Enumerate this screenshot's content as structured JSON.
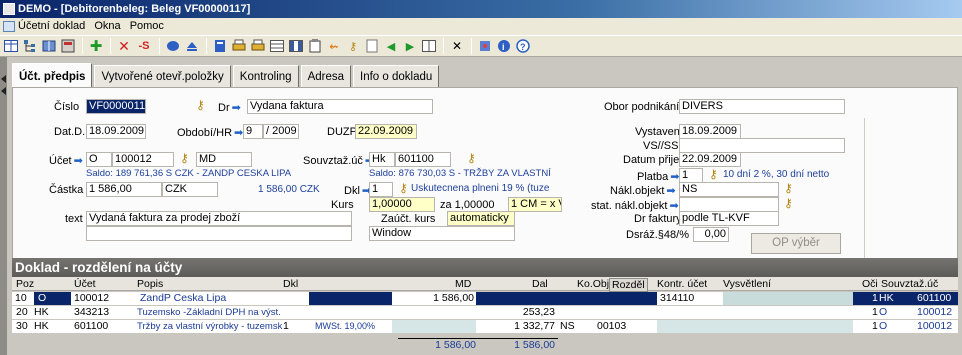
{
  "window": {
    "title": "DEMO - [Debitorenbeleg: Beleg VF00000117]"
  },
  "menu": {
    "items": [
      "Účetní doklad",
      "Okna",
      "Pomoc"
    ]
  },
  "toolbar": {
    "icons": [
      "grid-icon",
      "tree-icon",
      "book-icon",
      "catalog-icon",
      "add-icon",
      "delete-icon",
      "storno-icon",
      "disk-icon",
      "eject-icon",
      "doc-icon",
      "printer-icon",
      "printer2-icon",
      "table-icon",
      "columns-icon",
      "clipboard-icon",
      "link-icon",
      "key-icon",
      "export-icon",
      "prev-icon",
      "next-icon",
      "last-icon",
      "close-icon",
      "puzzle-icon",
      "info-icon",
      "help-icon"
    ],
    "storno_label": "-S"
  },
  "tabs": [
    "Účt. předpis",
    "Vytvořené otevř.položky",
    "Kontroling",
    "Adresa",
    "Info o dokladu"
  ],
  "form": {
    "cislo_label": "Číslo",
    "cislo_value": "VF00000117",
    "dr_label": "Dr",
    "dr_value": "Vydana faktura",
    "obor_label": "Obor podnikání",
    "obor_value": "DIVERS",
    "datd_label": "Dat.D.",
    "datd_value": "18.09.2009",
    "obdobi_label": "Období/HR",
    "obdobi_month": "9",
    "obdobi_year": "/ 2009",
    "duzp_label": "DUZP",
    "duzp_value": "22.09.2009",
    "vystaven_label": "Vystaven",
    "vystaven_value": "18.09.2009",
    "vsss_label": "VS//SS",
    "vsss_value": "",
    "ucet_label": "Účet",
    "ucet_type": "O",
    "ucet_num": "100012",
    "ucet_md": "MD",
    "saldo1": "Saldo:  189 761,36 S CZK -  ZANDP CESKA LIPA",
    "souvzt_label": "Souvztaž.úč",
    "souvzt_type": "Hk",
    "souvzt_num": "601100",
    "saldo2": "Saldo:  876 730,03 S -  TRŽBY ZA VLASTNÍ",
    "datprijeti_label": "Datum přijetí",
    "datprijeti_value": "22.09.2009",
    "platba_label": "Platba",
    "platba_value": "1",
    "platba_text": "10 dní 2 %, 30 dní netto",
    "castka_label": "Částka",
    "castka_value": "1 586,00",
    "castka_currency": "CZK",
    "castka_czk": "1 586,00 CZK",
    "dkl_label": "Dkl",
    "dkl_value": "1",
    "dkl_text": "Uskutecnena plneni 19 % (tuze",
    "naklobj_label": "Nákl.objekt",
    "naklobj_value": "NS",
    "kurs_label": "Kurs",
    "kurs_value": "1,00000",
    "kurs_za": "za 1,00000",
    "kurs_cm": "1 CM = x VM",
    "statnakl_label": "stat. nákl.objekt",
    "statnakl_value": "",
    "text_label": "text",
    "text_value": "Vydaná faktura za prodej zboží",
    "zauct_label": "Zaúčt. kurs",
    "zauct_value": "automaticky",
    "drfaktury_label": "Dr faktury",
    "drfaktury_value": "podle TL-KVF",
    "window_value": "Window",
    "dsraz_label": "Dsráž.§48/%",
    "dsraz_value": "0,00",
    "op_button": "OP výběr"
  },
  "grid": {
    "section_title": "Doklad - rozdělení na účty",
    "headers": [
      "Poz",
      "Účet",
      "Popis",
      "Dkl",
      "MD",
      "Dal",
      "Ko.Obj.",
      "Rozděl",
      "Kontr. účet",
      "Vysvětlení",
      "Oči",
      "Souvztaž.úč"
    ],
    "rows": [
      {
        "poz": "10",
        "type": "O",
        "ucet": "100012",
        "popis": "ZandP Ceska Lipa",
        "dkl": "",
        "mwst": "",
        "md": "1 586,00",
        "dal": "",
        "koobj": "",
        "rozdel": "",
        "kontr": "314110",
        "oci": "1",
        "stype": "HK",
        "souvzt": "601100"
      },
      {
        "poz": "20",
        "type": "HK",
        "ucet": "343213",
        "popis": "Tuzemsko -Základní DPH na výst.",
        "dkl": "",
        "mwst": "",
        "md": "",
        "dal": "253,23",
        "koobj": "",
        "rozdel": "",
        "kontr": "",
        "oci": "1",
        "stype": "O",
        "souvzt": "100012"
      },
      {
        "poz": "30",
        "type": "HK",
        "ucet": "601100",
        "popis": "Tržby za vlastní výrobky - tuzemsk",
        "dkl": "1",
        "mwst": "MWSt. 19,00%",
        "md": "",
        "dal": "1 332,77",
        "koobj": "NS",
        "rozdel": "00103",
        "kontr": "",
        "oci": "1",
        "stype": "O",
        "souvzt": "100012"
      }
    ],
    "sum_md": "1 586,00",
    "sum_dal": "1 586,00"
  },
  "colors": {
    "title_bar": "#0a246a",
    "selection": "#0a246a",
    "field_yellow": "#ffffc8",
    "link_blue": "#1b3b96"
  }
}
